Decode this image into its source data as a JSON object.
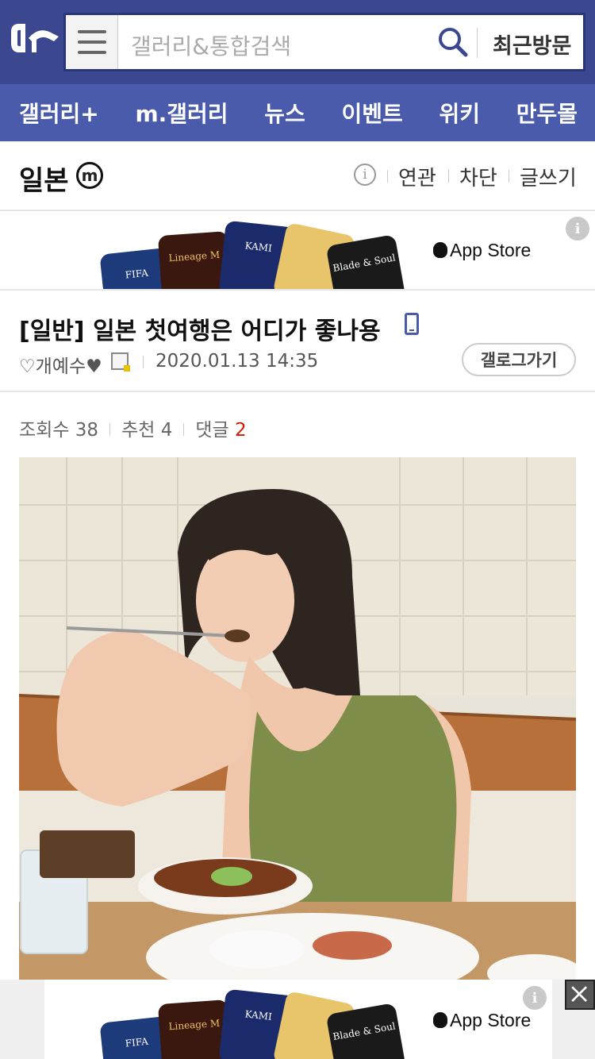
{
  "header": {
    "search_placeholder": "갤러리&통합검색",
    "recent_label": "최근방문"
  },
  "nav": {
    "items": [
      "갤러리+",
      "m.갤러리",
      "뉴스",
      "이벤트",
      "위키",
      "만두몰"
    ]
  },
  "gallery": {
    "title": "일본",
    "badge": "m",
    "links": [
      "연관",
      "차단",
      "글쓰기"
    ]
  },
  "ad": {
    "store_label": "App Store",
    "cards": [
      "FIFA",
      "Lineage M",
      "KAMI",
      "",
      "Blade & Soul"
    ],
    "info": "i"
  },
  "post": {
    "title": "[일반] 일본 첫여행은 어디가 좋나용",
    "author": "♡개예수♥",
    "date": "2020.01.13 14:35",
    "gallog_button": "갤로그가기"
  },
  "stats": {
    "views_label": "조회수",
    "views": "38",
    "recommend_label": "추천",
    "recommend": "4",
    "comments_label": "댓글",
    "comments": "2"
  },
  "colors": {
    "header_bg": "#3b4890",
    "nav_bg": "#4a5bab",
    "comment_count": "#d31900"
  }
}
